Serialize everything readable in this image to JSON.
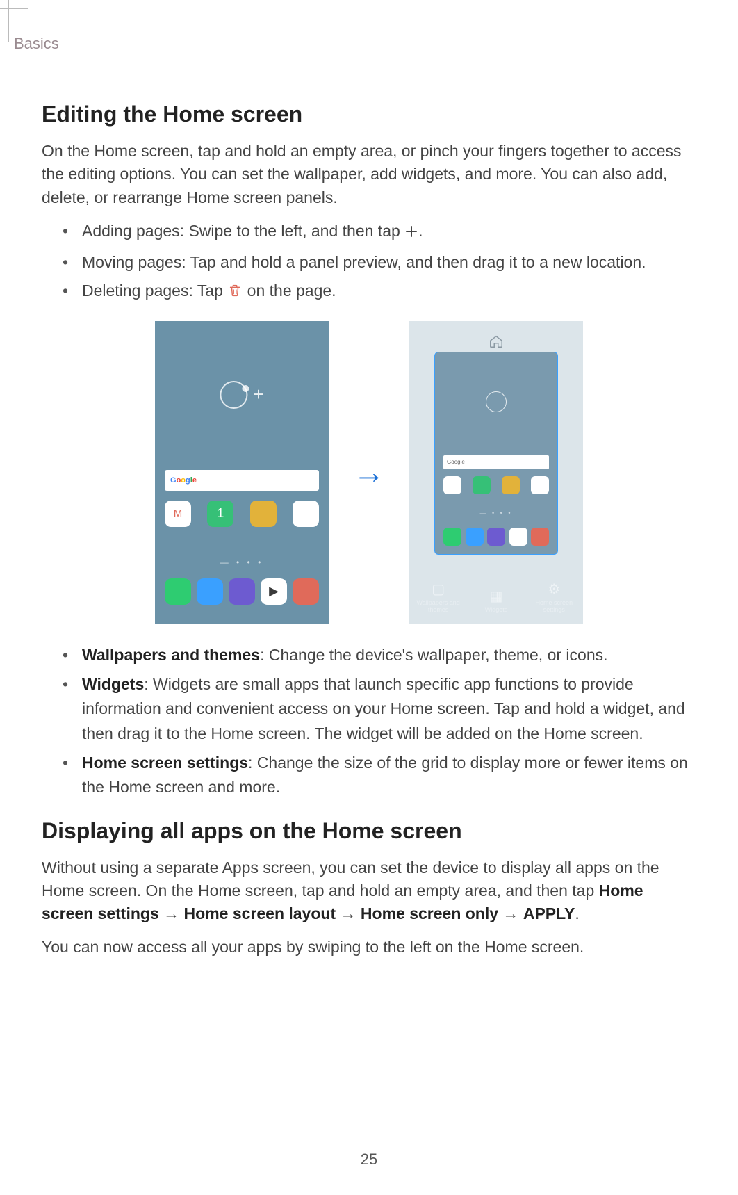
{
  "header": {
    "section": "Basics"
  },
  "h1": "Editing the Home screen",
  "intro": "On the Home screen, tap and hold an empty area, or pinch your fingers together to access the editing options. You can set the wallpaper, add widgets, and more. You can also add, delete, or rearrange Home screen panels.",
  "bullets1": {
    "adding_pre": "Adding pages: Swipe to the left, and then tap ",
    "adding_post": ".",
    "moving": "Moving pages: Tap and hold a panel preview, and then drag it to a new location.",
    "deleting_pre": "Deleting pages: Tap ",
    "deleting_post": " on the page."
  },
  "figure": {
    "arrow": "→",
    "phone1": {
      "search_label": "Google",
      "dots": "— • • •"
    },
    "phone2": {
      "tabs": [
        "Wallpapers and themes",
        "Widgets",
        "Home screen settings"
      ],
      "search_label": "Google",
      "dots": "— • • •"
    }
  },
  "bullets2": {
    "wallpapers_label": "Wallpapers and themes",
    "wallpapers_text": ": Change the device's wallpaper, theme, or icons.",
    "widgets_label": "Widgets",
    "widgets_text": ": Widgets are small apps that launch specific app functions to provide information and convenient access on your Home screen. Tap and hold a widget, and then drag it to the Home screen. The widget will be added on the Home screen.",
    "settings_label": "Home screen settings",
    "settings_text": ": Change the size of the grid to display more or fewer items on the Home screen and more."
  },
  "h2": "Displaying all apps on the Home screen",
  "p2_pre": "Without using a separate Apps screen, you can set the device to display all apps on the Home screen. On the Home screen, tap and hold an empty area, and then tap ",
  "p2_b1": "Home screen settings",
  "p2_arr": " → ",
  "p2_b2": "Home screen layout",
  "p2_b3": "Home screen only",
  "p2_b4": "APPLY",
  "p2_post": ".",
  "p3": "You can now access all your apps by swiping to the left on the Home screen.",
  "page_number": "25"
}
